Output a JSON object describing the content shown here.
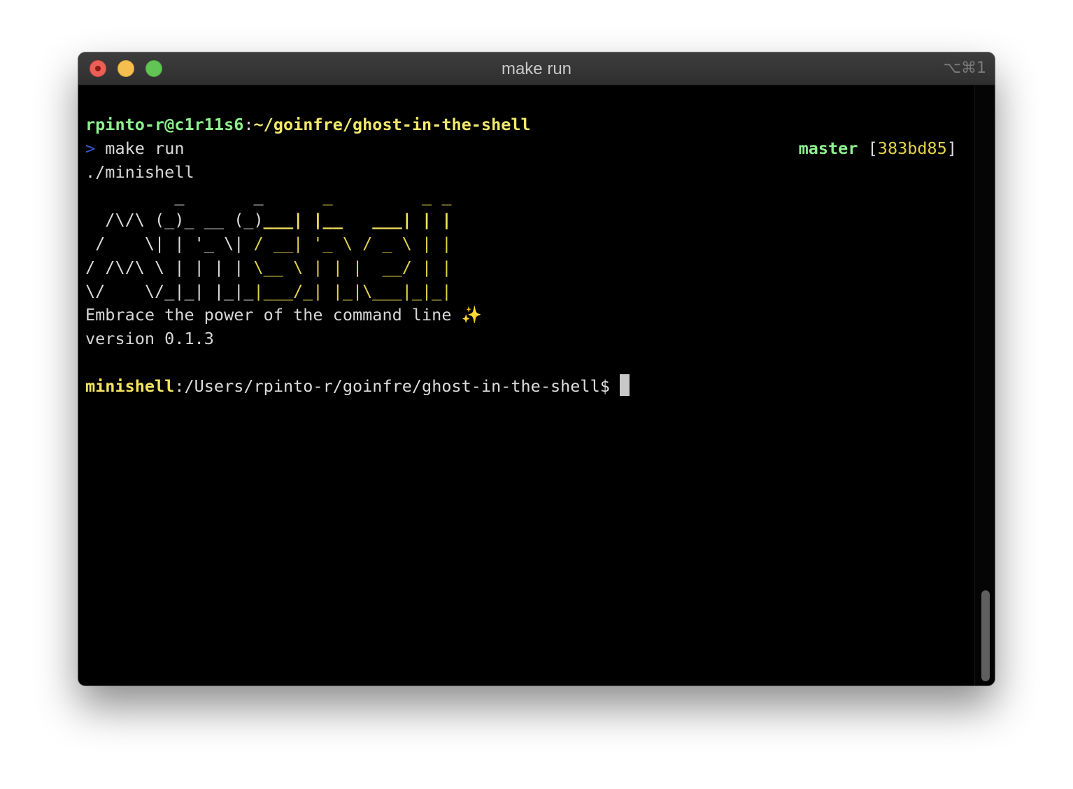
{
  "window": {
    "title": "make run",
    "shortcut": "⌥⌘1"
  },
  "prompt": {
    "user_host": "rpinto-r@c1r11s6",
    "separator": ":",
    "path": "~/goinfre/ghost-in-the-shell",
    "arrow": ">",
    "command": " make run",
    "branch": "master",
    "bracket_open": "[",
    "hash": "383bd85",
    "bracket_close": "]"
  },
  "output": {
    "exec_line": "./minishell",
    "ascii_art": [
      {
        "plain": "         _       _    ",
        "yellow": "  _         _ _"
      },
      {
        "plain": "  /\\/\\ (_)_ __ (_)",
        "yellow": "___| |__   ___| | |"
      },
      {
        "plain": " /    \\| | '_ \\| ",
        "yellow": "/ __| '_ \\ / _ \\ | |"
      },
      {
        "plain": "/ /\\/\\ \\ | | | | ",
        "yellow": "\\__ \\ | | |  __/ | |"
      },
      {
        "plain": "\\/    \\/_|_| |_|_",
        "yellow": "|___/_| |_|\\___|_|_|"
      }
    ],
    "tagline": "Embrace the power of the command line ✨",
    "version": "version 0.1.3"
  },
  "minishell_prompt": {
    "name": "minishell",
    "path": ":/Users/rpinto-r/goinfre/ghost-in-the-shell",
    "symbol": "$ "
  },
  "colors": {
    "green": "#8ef08e",
    "yellow": "#f2e86a",
    "background": "#000000",
    "text": "#d7d7d7",
    "arrow_blue": "#3b5bd6"
  }
}
